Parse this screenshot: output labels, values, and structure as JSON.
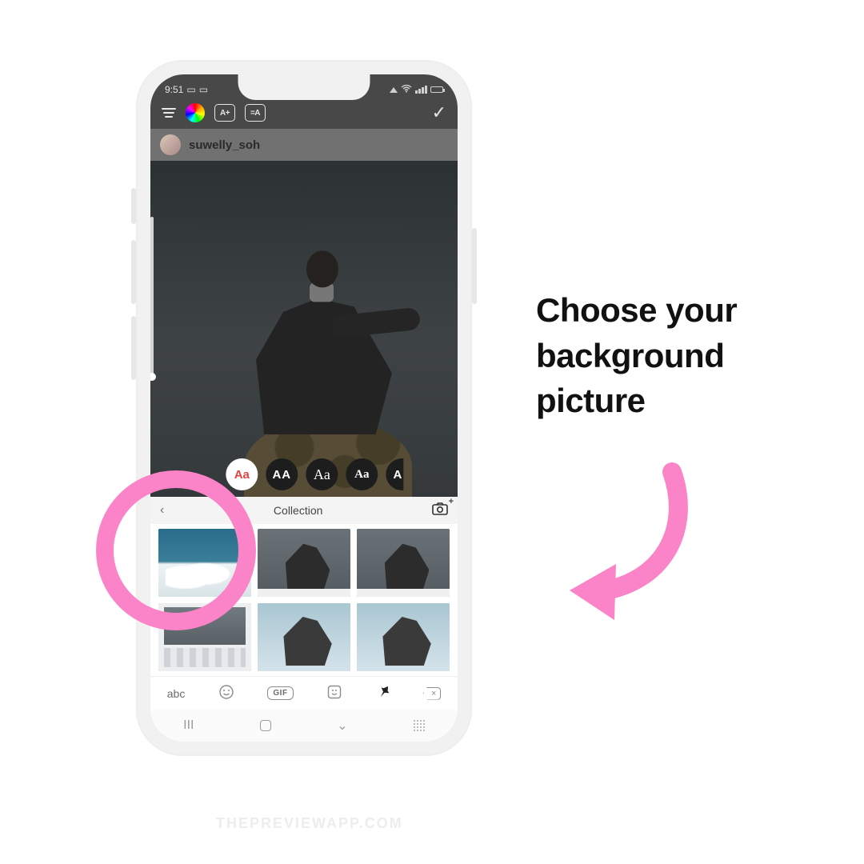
{
  "status": {
    "time": "9:51"
  },
  "toolbar": {
    "a_box": "A+",
    "eq_box": "=A"
  },
  "user": {
    "name": "suwelly_soh"
  },
  "font_pills": {
    "p1": "Aa",
    "p2": "AA",
    "p3": "Aa",
    "p4": "Aa",
    "p5": "A"
  },
  "collection": {
    "title": "Collection"
  },
  "keyboard": {
    "abc": "abc",
    "gif": "GIF"
  },
  "caption": {
    "text": "Choose your background picture"
  },
  "watermark": {
    "text": "THEPREVIEWAPP.COM"
  }
}
